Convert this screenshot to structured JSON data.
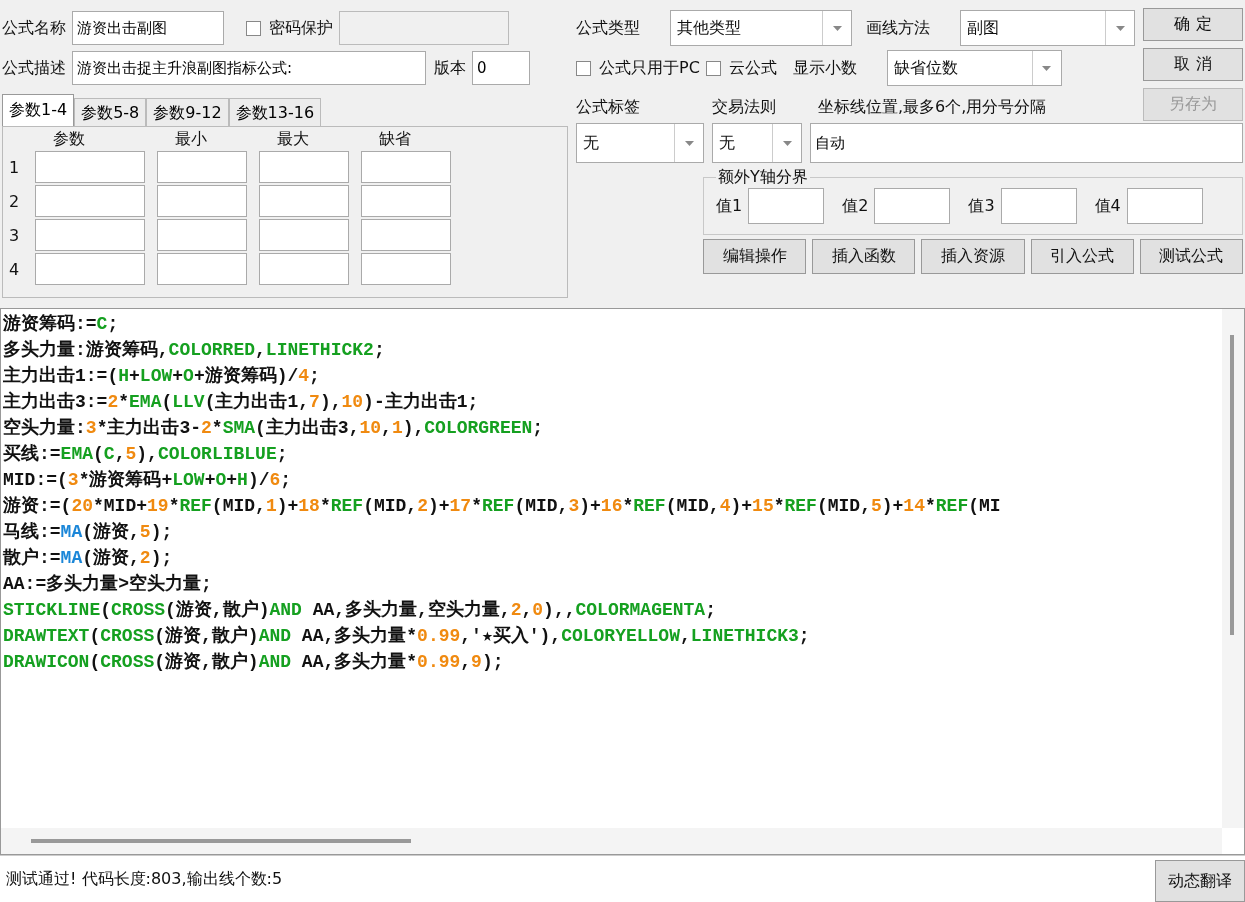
{
  "header": {
    "formula_name": {
      "label": "公式名称",
      "value": "游资出击副图"
    },
    "password": {
      "label": "密码保护",
      "checked": false
    },
    "password_field": {
      "disabled": true
    },
    "description": {
      "label": "公式描述",
      "value": "游资出击捉主升浪副图指标公式:"
    },
    "version": {
      "label": "版本",
      "value": "0"
    },
    "formula_type": {
      "label": "公式类型",
      "value": "其他类型"
    },
    "draw_method": {
      "label": "画线方法",
      "value": "副图"
    },
    "pc_only": {
      "label": "公式只用于PC",
      "checked": false
    },
    "cloud": {
      "label": "云公式",
      "checked": false
    },
    "decimals": {
      "label": "显示小数",
      "value": "缺省位数"
    },
    "tag": {
      "label": "公式标签",
      "value": "无"
    },
    "trade_rule": {
      "label": "交易法则",
      "value": "无"
    },
    "axis_lines": {
      "label": "坐标线位置,最多6个,用分号分隔",
      "value": "自动"
    }
  },
  "side_buttons": [
    {
      "label": "确 定",
      "disabled": false
    },
    {
      "label": "取 消",
      "disabled": false
    },
    {
      "label": "另存为",
      "disabled": true
    }
  ],
  "param_tabs": [
    {
      "label": "参数1-4",
      "selected": true
    },
    {
      "label": "参数5-8",
      "selected": false
    },
    {
      "label": "参数9-12",
      "selected": false
    },
    {
      "label": "参数13-16",
      "selected": false
    }
  ],
  "param_table": {
    "columns": [
      "参数",
      "最小",
      "最大",
      "缺省"
    ],
    "rows": [
      "1",
      "2",
      "3",
      "4"
    ]
  },
  "y_axis_group": {
    "title": "额外Y轴分界",
    "fields": [
      {
        "label": "值1"
      },
      {
        "label": "值2"
      },
      {
        "label": "值3"
      },
      {
        "label": "值4"
      }
    ]
  },
  "action_buttons": [
    "编辑操作",
    "插入函数",
    "插入资源",
    "引入公式",
    "测试公式"
  ],
  "code_lines": [
    [
      {
        "kind": "plain",
        "text": "游资筹码:="
      },
      {
        "kind": "keyword",
        "text": "C"
      },
      {
        "kind": "plain",
        "text": ";"
      }
    ],
    [
      {
        "kind": "plain",
        "text": "多头力量:游资筹码,"
      },
      {
        "kind": "keyword",
        "text": "COLORRED"
      },
      {
        "kind": "plain",
        "text": ","
      },
      {
        "kind": "keyword",
        "text": "LINETHICK2"
      },
      {
        "kind": "plain",
        "text": ";"
      }
    ],
    [
      {
        "kind": "plain",
        "text": "主力出击1:=("
      },
      {
        "kind": "keyword",
        "text": "H"
      },
      {
        "kind": "plain",
        "text": "+"
      },
      {
        "kind": "keyword",
        "text": "LOW"
      },
      {
        "kind": "plain",
        "text": "+"
      },
      {
        "kind": "keyword",
        "text": "O"
      },
      {
        "kind": "plain",
        "text": "+游资筹码)/"
      },
      {
        "kind": "number",
        "text": "4"
      },
      {
        "kind": "plain",
        "text": ";"
      }
    ],
    [
      {
        "kind": "plain",
        "text": "主力出击3:="
      },
      {
        "kind": "number",
        "text": "2"
      },
      {
        "kind": "plain",
        "text": "*"
      },
      {
        "kind": "keyword",
        "text": "EMA"
      },
      {
        "kind": "plain",
        "text": "("
      },
      {
        "kind": "keyword",
        "text": "LLV"
      },
      {
        "kind": "plain",
        "text": "(主力出击1,"
      },
      {
        "kind": "number",
        "text": "7"
      },
      {
        "kind": "plain",
        "text": "),"
      },
      {
        "kind": "number",
        "text": "10"
      },
      {
        "kind": "plain",
        "text": ")-主力出击1;"
      }
    ],
    [
      {
        "kind": "plain",
        "text": "空头力量:"
      },
      {
        "kind": "number",
        "text": "3"
      },
      {
        "kind": "plain",
        "text": "*主力出击3-"
      },
      {
        "kind": "number",
        "text": "2"
      },
      {
        "kind": "plain",
        "text": "*"
      },
      {
        "kind": "keyword",
        "text": "SMA"
      },
      {
        "kind": "plain",
        "text": "(主力出击3,"
      },
      {
        "kind": "number",
        "text": "10"
      },
      {
        "kind": "plain",
        "text": ","
      },
      {
        "kind": "number",
        "text": "1"
      },
      {
        "kind": "plain",
        "text": "),"
      },
      {
        "kind": "keyword",
        "text": "COLORGREEN"
      },
      {
        "kind": "plain",
        "text": ";"
      }
    ],
    [
      {
        "kind": "plain",
        "text": "买线:="
      },
      {
        "kind": "keyword",
        "text": "EMA"
      },
      {
        "kind": "plain",
        "text": "("
      },
      {
        "kind": "keyword",
        "text": "C"
      },
      {
        "kind": "plain",
        "text": ","
      },
      {
        "kind": "number",
        "text": "5"
      },
      {
        "kind": "plain",
        "text": "),"
      },
      {
        "kind": "keyword",
        "text": "COLORLIBLUE"
      },
      {
        "kind": "plain",
        "text": ";"
      }
    ],
    [
      {
        "kind": "plain",
        "text": "MID:=("
      },
      {
        "kind": "number",
        "text": "3"
      },
      {
        "kind": "plain",
        "text": "*游资筹码+"
      },
      {
        "kind": "keyword",
        "text": "LOW"
      },
      {
        "kind": "plain",
        "text": "+"
      },
      {
        "kind": "keyword",
        "text": "O"
      },
      {
        "kind": "plain",
        "text": "+"
      },
      {
        "kind": "keyword",
        "text": "H"
      },
      {
        "kind": "plain",
        "text": ")/"
      },
      {
        "kind": "number",
        "text": "6"
      },
      {
        "kind": "plain",
        "text": ";"
      }
    ],
    [
      {
        "kind": "plain",
        "text": "游资:=("
      },
      {
        "kind": "number",
        "text": "20"
      },
      {
        "kind": "plain",
        "text": "*MID+"
      },
      {
        "kind": "number",
        "text": "19"
      },
      {
        "kind": "plain",
        "text": "*"
      },
      {
        "kind": "keyword",
        "text": "REF"
      },
      {
        "kind": "plain",
        "text": "(MID,"
      },
      {
        "kind": "number",
        "text": "1"
      },
      {
        "kind": "plain",
        "text": ")+"
      },
      {
        "kind": "number",
        "text": "18"
      },
      {
        "kind": "plain",
        "text": "*"
      },
      {
        "kind": "keyword",
        "text": "REF"
      },
      {
        "kind": "plain",
        "text": "(MID,"
      },
      {
        "kind": "number",
        "text": "2"
      },
      {
        "kind": "plain",
        "text": ")+"
      },
      {
        "kind": "number",
        "text": "17"
      },
      {
        "kind": "plain",
        "text": "*"
      },
      {
        "kind": "keyword",
        "text": "REF"
      },
      {
        "kind": "plain",
        "text": "(MID,"
      },
      {
        "kind": "number",
        "text": "3"
      },
      {
        "kind": "plain",
        "text": ")+"
      },
      {
        "kind": "number",
        "text": "16"
      },
      {
        "kind": "plain",
        "text": "*"
      },
      {
        "kind": "keyword",
        "text": "REF"
      },
      {
        "kind": "plain",
        "text": "(MID,"
      },
      {
        "kind": "number",
        "text": "4"
      },
      {
        "kind": "plain",
        "text": ")+"
      },
      {
        "kind": "number",
        "text": "15"
      },
      {
        "kind": "plain",
        "text": "*"
      },
      {
        "kind": "keyword",
        "text": "REF"
      },
      {
        "kind": "plain",
        "text": "(MID,"
      },
      {
        "kind": "number",
        "text": "5"
      },
      {
        "kind": "plain",
        "text": ")+"
      },
      {
        "kind": "number",
        "text": "14"
      },
      {
        "kind": "plain",
        "text": "*"
      },
      {
        "kind": "keyword",
        "text": "REF"
      },
      {
        "kind": "plain",
        "text": "(MI"
      }
    ],
    [
      {
        "kind": "plain",
        "text": "马线:="
      },
      {
        "kind": "function",
        "text": "MA"
      },
      {
        "kind": "plain",
        "text": "(游资,"
      },
      {
        "kind": "number",
        "text": "5"
      },
      {
        "kind": "plain",
        "text": ");"
      }
    ],
    [
      {
        "kind": "plain",
        "text": "散户:="
      },
      {
        "kind": "function",
        "text": "MA"
      },
      {
        "kind": "plain",
        "text": "(游资,"
      },
      {
        "kind": "number",
        "text": "2"
      },
      {
        "kind": "plain",
        "text": ");"
      }
    ],
    [
      {
        "kind": "plain",
        "text": "AA:=多头力量>空头力量;"
      }
    ],
    [
      {
        "kind": "keyword",
        "text": "STICKLINE"
      },
      {
        "kind": "plain",
        "text": "("
      },
      {
        "kind": "keyword",
        "text": "CROSS"
      },
      {
        "kind": "plain",
        "text": "(游资,散户)"
      },
      {
        "kind": "keyword",
        "text": "AND"
      },
      {
        "kind": "plain",
        "text": " AA,多头力量,空头力量,"
      },
      {
        "kind": "number",
        "text": "2"
      },
      {
        "kind": "plain",
        "text": ","
      },
      {
        "kind": "number",
        "text": "0"
      },
      {
        "kind": "plain",
        "text": "),,"
      },
      {
        "kind": "keyword",
        "text": "COLORMAGENTA"
      },
      {
        "kind": "plain",
        "text": ";"
      }
    ],
    [
      {
        "kind": "keyword",
        "text": "DRAWTEXT"
      },
      {
        "kind": "plain",
        "text": "("
      },
      {
        "kind": "keyword",
        "text": "CROSS"
      },
      {
        "kind": "plain",
        "text": "(游资,散户)"
      },
      {
        "kind": "keyword",
        "text": "AND"
      },
      {
        "kind": "plain",
        "text": " AA,多头力量*"
      },
      {
        "kind": "number",
        "text": "0.99"
      },
      {
        "kind": "plain",
        "text": ",'★买入'),"
      },
      {
        "kind": "keyword",
        "text": "COLORYELLOW"
      },
      {
        "kind": "plain",
        "text": ","
      },
      {
        "kind": "keyword",
        "text": "LINETHICK3"
      },
      {
        "kind": "plain",
        "text": ";"
      }
    ],
    [
      {
        "kind": "keyword",
        "text": "DRAWICON"
      },
      {
        "kind": "plain",
        "text": "("
      },
      {
        "kind": "keyword",
        "text": "CROSS"
      },
      {
        "kind": "plain",
        "text": "(游资,散户)"
      },
      {
        "kind": "keyword",
        "text": "AND"
      },
      {
        "kind": "plain",
        "text": " AA,多头力量*"
      },
      {
        "kind": "number",
        "text": "0.99"
      },
      {
        "kind": "plain",
        "text": ","
      },
      {
        "kind": "number",
        "text": "9"
      },
      {
        "kind": "plain",
        "text": ");"
      }
    ]
  ],
  "status_bar": {
    "message": "测试通过! 代码长度:803,输出线个数:5",
    "button": "动态翻译"
  }
}
